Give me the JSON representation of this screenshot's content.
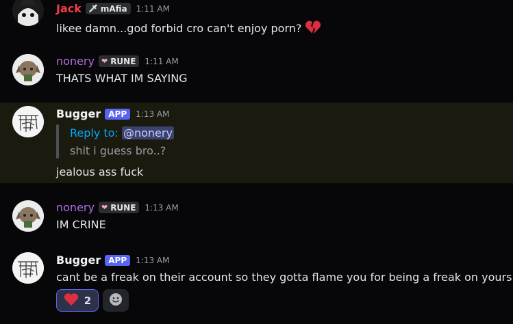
{
  "messages": [
    {
      "author": "Jack",
      "author_color": "#f23f42",
      "tag": "mAfia",
      "tag_icon": "sword-icon",
      "time": "1:11 AM",
      "text": "likee damn...god forbid cro can't enjoy porn?",
      "emoji": "broken-heart-icon"
    },
    {
      "author": "nonery",
      "author_color": "#b36ee0",
      "tag": "RUNE",
      "tag_icon": "heart-icon",
      "time": "1:11 AM",
      "text": "THATS WHAT IM SAYING"
    },
    {
      "author": "Bugger",
      "author_color": "#f2f3f5",
      "badge": "APP",
      "time": "1:13 AM",
      "reply_prefix": "Reply to:",
      "reply_mention": "@nonery",
      "quoted_text": "shit i guess bro..?",
      "text": "jealous ass fuck",
      "highlighted": true
    },
    {
      "author": "nonery",
      "author_color": "#b36ee0",
      "tag": "RUNE",
      "tag_icon": "heart-icon",
      "time": "1:13 AM",
      "text": "IM CRINE"
    },
    {
      "author": "Bugger",
      "author_color": "#f2f3f5",
      "badge": "APP",
      "time": "1:13 AM",
      "text": "cant be a freak on their account so they gotta flame you for being a freak on yours",
      "reactions": [
        {
          "emoji": "red-heart-icon",
          "count": "2"
        }
      ]
    }
  ],
  "colors": {
    "background": "#070709",
    "highlight": "#1b1a0e",
    "app_badge": "#5865f2",
    "link": "#00a8fc"
  }
}
